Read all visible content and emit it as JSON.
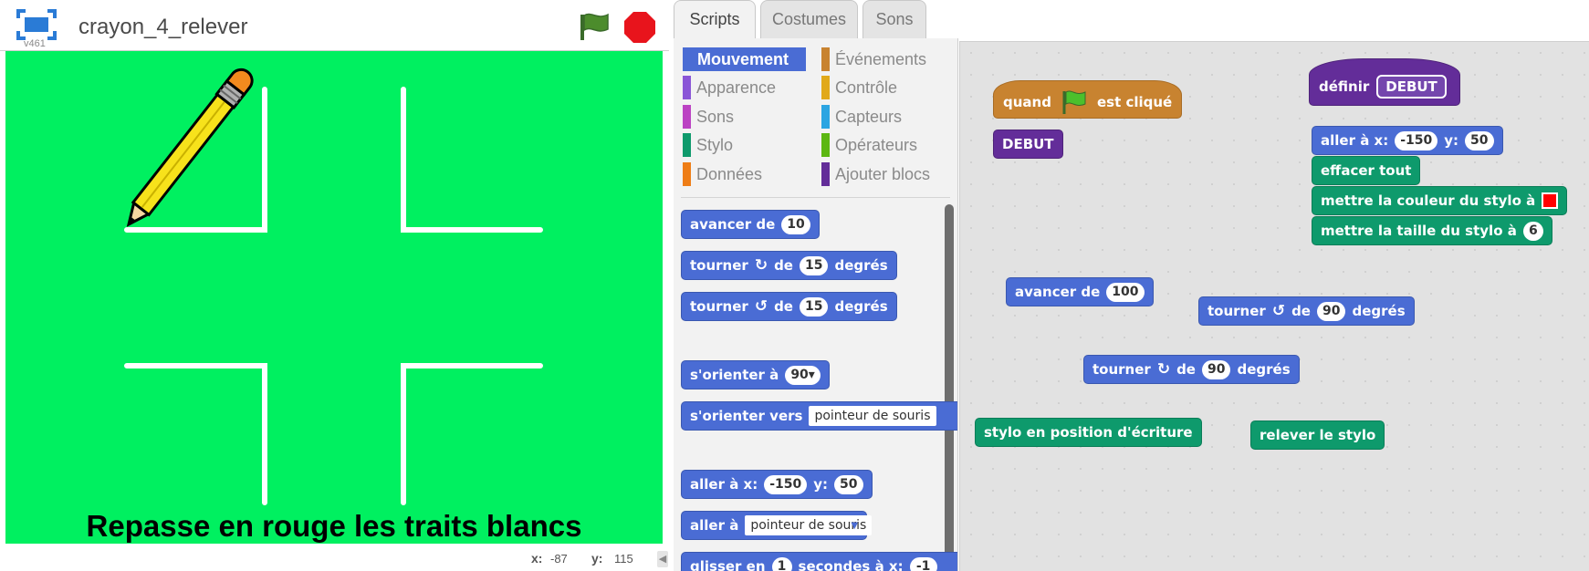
{
  "stage": {
    "version": "v461",
    "project_title": "crayon_4_relever",
    "caption": "Repasse en rouge les traits blancs",
    "mouse_x_label": "x:",
    "mouse_x": "-87",
    "mouse_y_label": "y:",
    "mouse_y": "115",
    "background_color": "#00f060",
    "line_color": "#ffffff"
  },
  "tabs": [
    "Scripts",
    "Costumes",
    "Sons"
  ],
  "palette": {
    "categories_left": [
      {
        "label": "Mouvement",
        "color": "#4a6cd4",
        "selected": true
      },
      {
        "label": "Apparence",
        "color": "#8a55d7"
      },
      {
        "label": "Sons",
        "color": "#bb42c3"
      },
      {
        "label": "Stylo",
        "color": "#0e9a6c"
      },
      {
        "label": "Données",
        "color": "#ee7d16"
      }
    ],
    "categories_right": [
      {
        "label": "Événements",
        "color": "#c88330"
      },
      {
        "label": "Contrôle",
        "color": "#e1a91a"
      },
      {
        "label": "Capteurs",
        "color": "#2ca5e2"
      },
      {
        "label": "Opérateurs",
        "color": "#5cb712"
      },
      {
        "label": "Ajouter blocs",
        "color": "#632d99"
      }
    ],
    "blocks": {
      "move": {
        "label": "avancer de",
        "value": "10"
      },
      "turn_right": {
        "label": "tourner",
        "de": "de",
        "value": "15",
        "unit": "degrés"
      },
      "turn_left": {
        "label": "tourner",
        "de": "de",
        "value": "15",
        "unit": "degrés"
      },
      "point_dir": {
        "label": "s'orienter à",
        "value": "90▾"
      },
      "point_towards": {
        "label": "s'orienter vers",
        "value": "pointeur de souris"
      },
      "go_xy": {
        "label": "aller à x:",
        "x": "-150",
        "ylabel": "y:",
        "y": "50"
      },
      "go_to": {
        "label": "aller à",
        "value": "pointeur de souris"
      },
      "glide": {
        "label": "glisser en",
        "value": "1",
        "rest": "secondes à x:",
        "x": "-1"
      }
    }
  },
  "scripts": {
    "when_flag": {
      "quand": "quand",
      "est": "est cliqué"
    },
    "debut_call": "DEBUT",
    "define": {
      "label": "définir",
      "name": "DEBUT"
    },
    "define_body": {
      "goto": {
        "label": "aller à x:",
        "x": "-150",
        "ylabel": "y:",
        "y": "50"
      },
      "clear": "effacer tout",
      "set_color": {
        "label": "mettre la couleur du stylo à",
        "color": "#ff0000"
      },
      "set_size": {
        "label": "mettre la taille du stylo à",
        "value": "6"
      }
    },
    "move100": {
      "label": "avancer de",
      "value": "100"
    },
    "turn_left90": {
      "label": "tourner",
      "de": "de",
      "value": "90",
      "unit": "degrés"
    },
    "turn_right90": {
      "label": "tourner",
      "de": "de",
      "value": "90",
      "unit": "degrés"
    },
    "pen_down": "stylo en position d'écriture",
    "pen_up": "relever le stylo"
  }
}
